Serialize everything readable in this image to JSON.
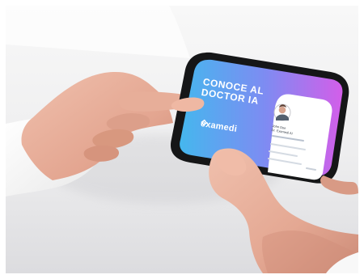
{
  "photo": {
    "headline": "CONOCE AL DOCTOR IA",
    "brand": "examedi",
    "card_name_line1": "John Doe",
    "card_name_line2": "Dr. Examedi AI",
    "colors": {
      "screen_start": "#45b7ee",
      "screen_mid": "#7d8cf2",
      "screen_end": "#d35ee9",
      "phone_body": "#171818",
      "skin": "#e6ad98",
      "sleeve": "#f7f7f6",
      "card": "#ffffff"
    }
  }
}
